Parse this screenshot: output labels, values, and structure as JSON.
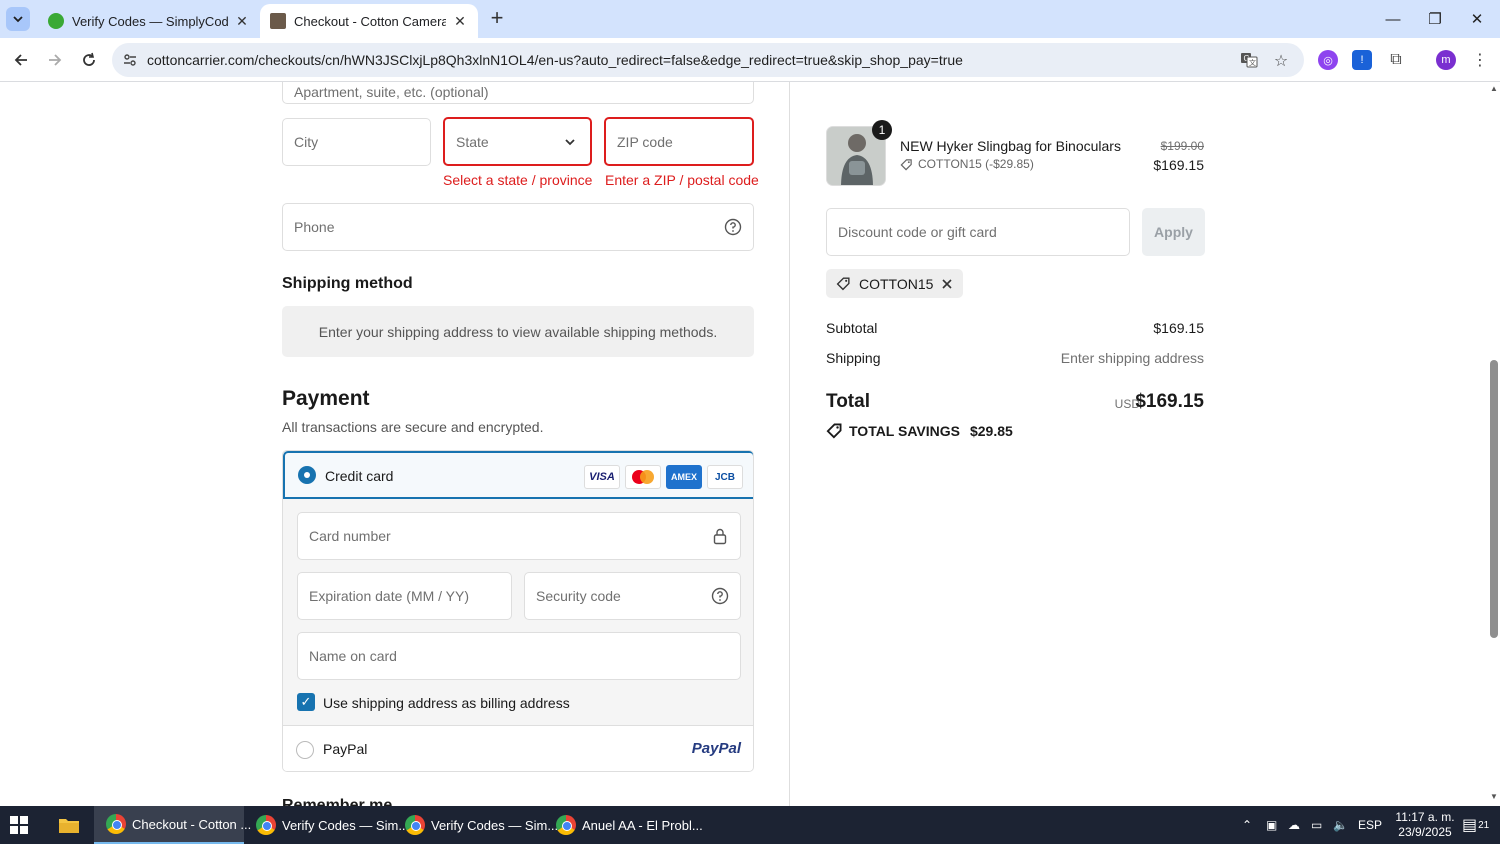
{
  "browser": {
    "tabs": [
      {
        "title": "Verify Codes — SimplyCodes",
        "active": false
      },
      {
        "title": "Checkout - Cotton Camera Carr",
        "active": true
      }
    ],
    "new_tab_symbol": "+",
    "url": "cottoncarrier.com/checkouts/cn/hWN3JSClxjLp8Qh3xlnN1OL4/en-us?auto_redirect=false&edge_redirect=true&skip_shop_pay=true",
    "profile_initial": "m"
  },
  "address": {
    "apartment_placeholder": "Apartment, suite, etc. (optional)",
    "city_placeholder": "City",
    "state_placeholder": "State",
    "state_error": "Select a state / province",
    "zip_placeholder": "ZIP code",
    "zip_error": "Enter a ZIP / postal code",
    "phone_placeholder": "Phone"
  },
  "shipping_method": {
    "heading": "Shipping method",
    "message": "Enter your shipping address to view available shipping methods."
  },
  "payment": {
    "heading": "Payment",
    "subtitle": "All transactions are secure and encrypted.",
    "credit_card_label": "Credit card",
    "card_brands": [
      "VISA",
      "mastercard",
      "AMEX",
      "JCB"
    ],
    "card_number_placeholder": "Card number",
    "expiration_placeholder": "Expiration date (MM / YY)",
    "security_code_placeholder": "Security code",
    "name_on_card_placeholder": "Name on card",
    "billing_checkbox_label": "Use shipping address as billing address",
    "billing_checked": true,
    "paypal_label": "PayPal",
    "paypal_logo": "PayPal"
  },
  "remember_me_heading": "Remember me",
  "summary": {
    "quantity_badge": "1",
    "product_name": "NEW Hyker Slingbag for Binoculars",
    "product_discount": "COTTON15 (-$29.85)",
    "price_original": "$199.00",
    "price_final": "$169.15",
    "discount_placeholder": "Discount code or gift card",
    "apply_label": "Apply",
    "applied_code": "COTTON15",
    "subtotal_label": "Subtotal",
    "subtotal_value": "$169.15",
    "shipping_label": "Shipping",
    "shipping_value": "Enter shipping address",
    "total_label": "Total",
    "total_currency": "USD",
    "total_value": "$169.15",
    "savings_label": "TOTAL SAVINGS",
    "savings_value": "$29.85"
  },
  "taskbar": {
    "items": [
      {
        "label": "Checkout - Cotton ..."
      },
      {
        "label": "Verify Codes — Sim..."
      },
      {
        "label": "Verify Codes — Sim..."
      },
      {
        "label": "Anuel AA - El Probl..."
      }
    ],
    "language": "ESP",
    "time": "11:17 a. m.",
    "date": "23/9/2025",
    "notification_count": "21"
  },
  "colors": {
    "accent": "#1773b0",
    "error": "#dd1d1d",
    "chrome_tabstrip": "#d3e3fd",
    "taskbar": "#1c2333"
  }
}
